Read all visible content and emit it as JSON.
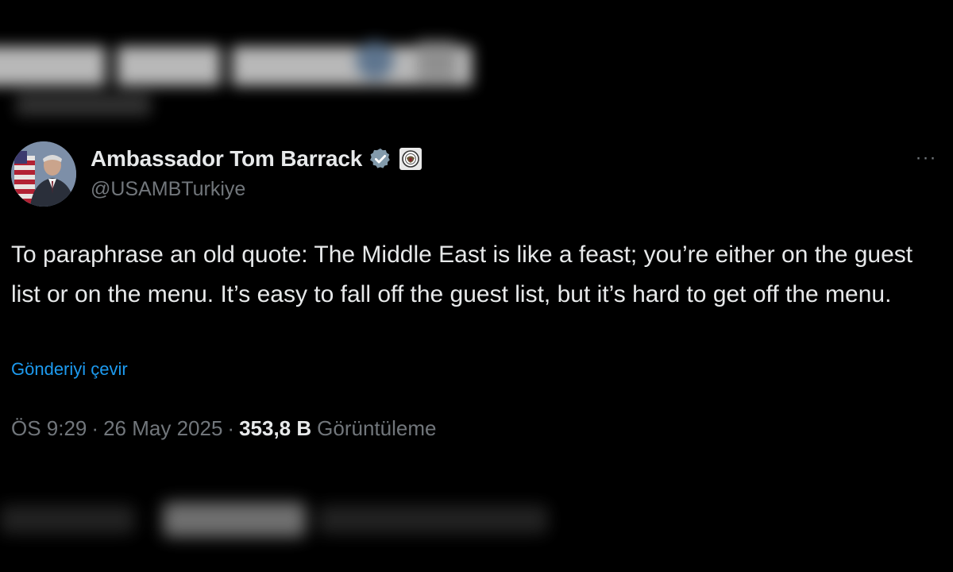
{
  "tweet": {
    "display_name": "Ambassador Tom Barrack",
    "handle": "@USAMBTurkiye",
    "text": "To paraphrase an old quote: The Middle East is like a feast; you’re either on the guest list or on the menu. It’s easy to fall off the guest list, but it’s hard to get off the menu.",
    "translate_label": "Gönderiyi çevir",
    "time": "ÖS 9:29",
    "date": "26 May 2025",
    "separator": "·",
    "views_count": "353,8 B",
    "views_label": "Görüntüleme",
    "more_label": "···",
    "icons": {
      "verified": "verified-badge-icon",
      "affiliation": "government-seal-icon",
      "more": "more-options-icon"
    }
  },
  "colors": {
    "background": "#000000",
    "primary_text": "#e7e9ea",
    "secondary_text": "#71767b",
    "link": "#1d9bf0",
    "verified": "#829aab"
  }
}
